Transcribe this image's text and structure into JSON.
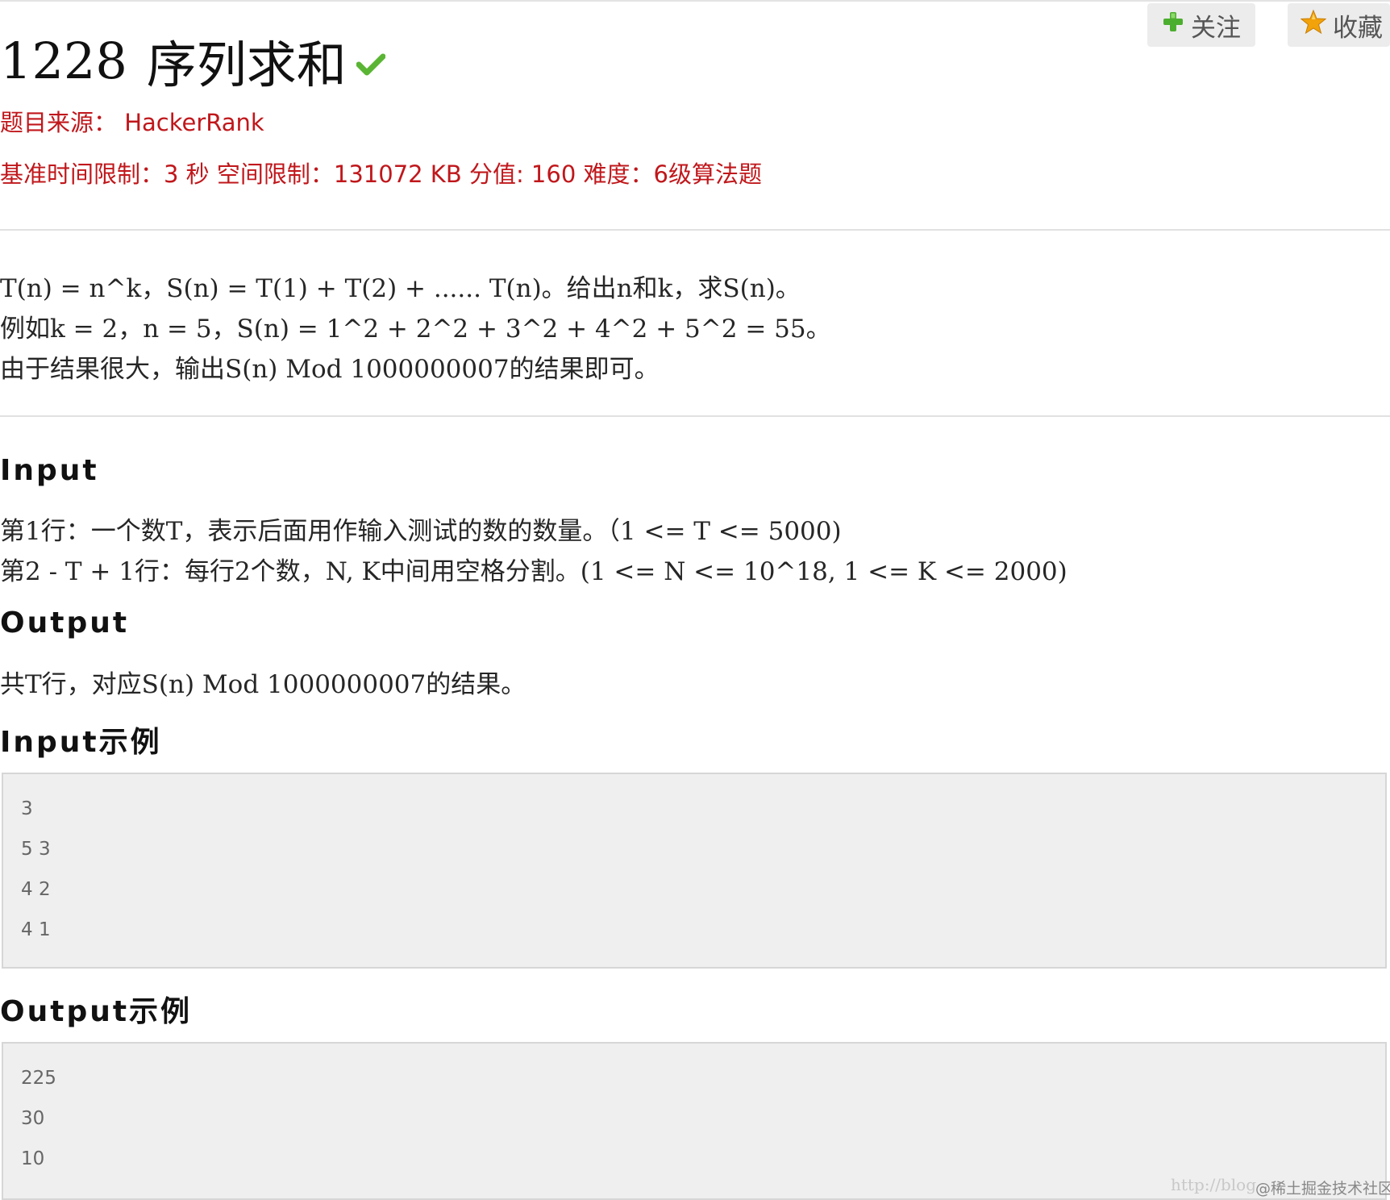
{
  "header": {
    "follow_label": "关注",
    "favorite_label": "收藏"
  },
  "problem": {
    "number": "1228",
    "name": "序列求和",
    "source_line": "题目来源： HackerRank",
    "limits_line": "基准时间限制：3 秒 空间限制：131072 KB 分值: 160 难度：6级算法题"
  },
  "description": {
    "lines": [
      "T(n) = n^k，S(n) = T(1) + T(2) + ...... T(n)。给出n和k，求S(n)。",
      "例如k = 2，n = 5，S(n) = 1^2 + 2^2 + 3^2 + 4^2 + 5^2 = 55。",
      "由于结果很大，输出S(n) Mod 1000000007的结果即可。"
    ]
  },
  "input": {
    "heading": "Input",
    "lines": [
      "第1行：一个数T，表示后面用作输入测试的数的数量。（1 <= T <= 5000)",
      "第2 - T + 1行：每行2个数，N, K中间用空格分割。(1 <= N <= 10^18, 1 <= K <= 2000)"
    ]
  },
  "output": {
    "heading": "Output",
    "lines": [
      "共T行，对应S(n) Mod 1000000007的结果。"
    ]
  },
  "input_example": {
    "heading": "Input示例",
    "rows": [
      "3",
      "5 3",
      "4 2",
      "4 1"
    ]
  },
  "output_example": {
    "heading": "Output示例",
    "rows": [
      "225",
      "30",
      "10"
    ]
  },
  "watermark": {
    "url": "http://blog",
    "label": "@稀土掘金技术社区"
  },
  "colors": {
    "accent_red": "#c0171b",
    "check_green": "#5bb534",
    "follow_icon_green": "#4cae2f",
    "star_orange": "#f2a20a"
  }
}
